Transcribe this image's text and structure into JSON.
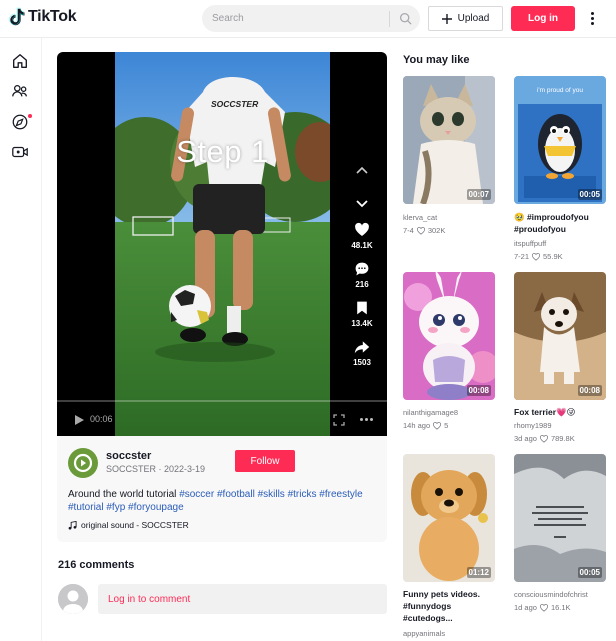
{
  "header": {
    "logo_text": "TikTok",
    "search_placeholder": "Search",
    "upload_label": "Upload",
    "login_label": "Log in"
  },
  "video": {
    "overlay_text": "Step 1",
    "shirt_text": "SOCCSTER",
    "time": "00:06",
    "progress": 0.0,
    "likes": "48.1K",
    "comments": "216",
    "saves": "13.4K",
    "shares": "1503"
  },
  "author": {
    "username": "soccster",
    "display": "SOCCSTER · 2022-3-19",
    "follow_label": "Follow"
  },
  "caption": {
    "text": "Around the world tutorial",
    "tags": [
      "#soccer",
      "#football",
      "#skills",
      "#tricks",
      "#freestyle",
      "#tutorial",
      "#fyp",
      "#foryoupage"
    ],
    "sound": "original sound - SOCCSTER"
  },
  "comments": {
    "title": "216 comments",
    "login_prompt": "Log in to comment"
  },
  "aside": {
    "title": "You may like",
    "items": [
      {
        "duration": "00:07",
        "title": "",
        "user": "klerva_cat",
        "date": "7-4",
        "likes": "302K"
      },
      {
        "duration": "00:05",
        "title": "🥹 #improudofyou #proudofyou",
        "user": "itspuffpuff",
        "date": "7-21",
        "likes": "55.9K",
        "thumb_text": "i'm proud of you"
      },
      {
        "duration": "00:08",
        "title": "",
        "user": "nilanthigamage8",
        "date": "14h ago",
        "likes": "5"
      },
      {
        "duration": "00:08",
        "title": "Fox terrier💗😜",
        "user": "rhomy1989",
        "date": "3d ago",
        "likes": "789.8K"
      },
      {
        "duration": "01:12",
        "title": "Funny pets videos. #funnydogs #cutedogs...",
        "user": "appyanimals",
        "date": "",
        "likes": ""
      },
      {
        "duration": "00:05",
        "title": "",
        "user": "consciousmindofchrist",
        "date": "1d ago",
        "likes": "16.1K"
      }
    ]
  },
  "colors": {
    "brand": "#fe2c55",
    "tag": "#2b5db9"
  }
}
